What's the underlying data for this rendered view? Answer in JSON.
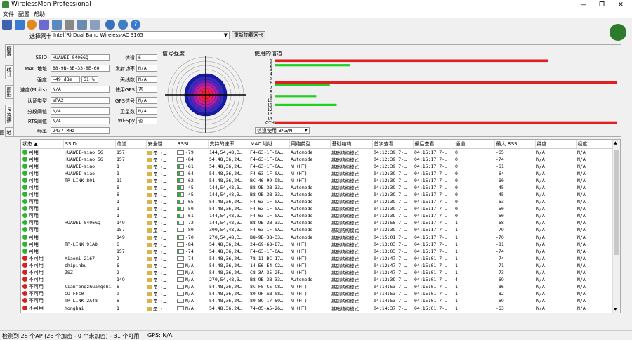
{
  "window": {
    "title": "WirelessMon Professional",
    "minimize": "—",
    "maximize": "❐",
    "close": "✕"
  },
  "menu": [
    "文件",
    "配置",
    "帮助"
  ],
  "toolbar_icons": [
    "save-icon",
    "refresh-icon",
    "settings-icon",
    "export-icon",
    "print-icon",
    "clipboard-icon",
    "map-icon",
    "info-icon",
    "forward-icon",
    "help-icon"
  ],
  "nic": {
    "label": "选择网卡",
    "value": "Intel(R) Dual Band Wireless-AC 3165",
    "reload": "重新加载网卡"
  },
  "side_tabs": [
    "概要",
    "统计",
    "图形",
    "IP 连接",
    "地图"
  ],
  "summary": {
    "ssid": {
      "label": "SSID",
      "value": "HUAWEI-0406GQ"
    },
    "mac": {
      "label": "MAC 地址",
      "value": "B8-9B-3B-33-8E-60"
    },
    "strength": {
      "label": "强度",
      "value": "-49 dBm",
      "pct": "51 %"
    },
    "speed": {
      "label": "速度(Mbits)",
      "value": "N/A"
    },
    "auth": {
      "label": "认证类型",
      "value": "WPA2"
    },
    "frag": {
      "label": "分段阈值",
      "value": "N/A"
    },
    "rts": {
      "label": "RTS阈值",
      "value": "N/A"
    },
    "freq": {
      "label": "频率",
      "value": "2437 MHz"
    },
    "channel": {
      "label": "信道",
      "value": "6"
    },
    "txpower": {
      "label": "发射功率",
      "value": "N/A"
    },
    "antenna": {
      "label": "天线数",
      "value": "N/A"
    },
    "gps": {
      "label": "使用GPS",
      "value": "否"
    },
    "gpssig": {
      "label": "GPS信号",
      "value": "N/A"
    },
    "sat": {
      "label": "卫星数",
      "value": "N/A"
    },
    "wispy": {
      "label": "Wi-Spy",
      "value": "否"
    },
    "signal_title": "信号强度",
    "channel_title": "使用的信道",
    "channel_mode": "信道使用 B/G/N"
  },
  "channel_usage": {
    "labels": [
      "1",
      "2",
      "3",
      "4",
      "5",
      "6",
      "7",
      "8",
      "9",
      "10",
      "11",
      "12",
      "13",
      "14",
      "OTH"
    ],
    "red": [
      0.8,
      0,
      0,
      0,
      0,
      1.0,
      0,
      0,
      0,
      0,
      0,
      0,
      0,
      0,
      1.0
    ],
    "green": [
      0,
      0.22,
      0,
      0,
      0,
      0.16,
      0,
      0,
      0.12,
      0,
      0.18,
      0,
      0,
      0,
      0
    ]
  },
  "table": {
    "columns": [
      "状态",
      "SSID",
      "信道",
      "安全性",
      "RSSI",
      "支持的速率",
      "MAC 地址",
      "网络类型",
      "基础结构",
      "首次查看",
      "最后查看",
      "通道",
      "最大 RSSI",
      "纬度",
      "经度"
    ],
    "rows": [
      [
        "可用",
        "HUAWEI-miao_5G",
        "157",
        "是 (…",
        "-79",
        "144,54,48,3…",
        "F4-63-1F-0A…",
        "Automode",
        "基础结构模式",
        "04:12:39 7-…",
        "04:15:17 7-…",
        "0",
        "-65",
        "N/A",
        "N/A"
      ],
      [
        "可用",
        "HUAWEI-miao_5G",
        "157",
        "是 (…",
        "-84",
        "54,48,36,24…",
        "F4-63-1F-0A…",
        "Automode",
        "基础结构模式",
        "04:12:39 7-…",
        "04:15:17 7-…",
        "0",
        "-74",
        "N/A",
        "N/A"
      ],
      [
        "可用",
        "HUAWEI-miao",
        "1",
        "是 (…",
        "-61",
        "54,48,36,24…",
        "F4-63-1F-0A…",
        "N (HT)",
        "基础结构模式",
        "04:12:39 7-…",
        "04:15:17 7-…",
        "0",
        "-61",
        "N/A",
        "N/A"
      ],
      [
        "可用",
        "HUAWEI-miao",
        "1",
        "是 (…",
        "-64",
        "54,48,36,24…",
        "F4-63-1F-0A…",
        "N (HT)",
        "基础结构模式",
        "04:12:39 7-…",
        "04:15:17 7-…",
        "0",
        "-64",
        "N/A",
        "N/A"
      ],
      [
        "可用",
        "TP-LINK_801",
        "11",
        "是 (…",
        "-62",
        "54,48,36,24…",
        "BC-46-99-98…",
        "N (HT)",
        "基础结构模式",
        "04:12:39 7-…",
        "04:15:17 7-…",
        "0",
        "-60",
        "N/A",
        "N/A"
      ],
      [
        "可用",
        "",
        "6",
        "是 (…",
        "-45",
        "144,54,48,3…",
        "B8-9B-3B-33…",
        "Automode",
        "基础结构模式",
        "04:12:39 7-…",
        "04:15:17 7-…",
        "0",
        "-45",
        "N/A",
        "N/A"
      ],
      [
        "可用",
        "",
        "6",
        "是 (…",
        "-45",
        "144,54,48,3…",
        "B8-9B-3B-33…",
        "Automode",
        "基础结构模式",
        "04:12:39 7-…",
        "04:15:17 7-…",
        "0",
        "-45",
        "N/A",
        "N/A"
      ],
      [
        "可用",
        "",
        "1",
        "是 (…",
        "-65",
        "54,48,36,24…",
        "F4-63-1F-0A…",
        "Automode",
        "基础结构模式",
        "04:12:39 7-…",
        "04:15:17 7-…",
        "0",
        "-63",
        "N/A",
        "N/A"
      ],
      [
        "可用",
        "",
        "1",
        "是 (…",
        "-50",
        "54,48,36,24…",
        "F4-63-1F-0A…",
        "Automode",
        "基础结构模式",
        "04:12:39 7-…",
        "04:15:17 7-…",
        "0",
        "-50",
        "N/A",
        "N/A"
      ],
      [
        "可用",
        "",
        "1",
        "是 (…",
        "-61",
        "144,54,48,3…",
        "F4-63-1F-0A…",
        "Automode",
        "基础结构模式",
        "04:12:39 7-…",
        "04:15:17 7-…",
        "0",
        "-60",
        "N/A",
        "N/A"
      ],
      [
        "可用",
        "HUAWEI-0406GQ",
        "149",
        "是 (…",
        "-72",
        "144,54,48,3…",
        "B8-9B-3B-33…",
        "Automode",
        "基础结构模式",
        "04:12:55 7-…",
        "04:15:17 7-…",
        "1",
        "-68",
        "N/A",
        "N/A"
      ],
      [
        "可用",
        "",
        "157",
        "是 (…",
        "-80",
        "300,54,48,3…",
        "F4-63-1F-0A…",
        "Automode",
        "基础结构模式",
        "04:12:39 7-…",
        "04:15:17 7-…",
        "1",
        "-79",
        "N/A",
        "N/A"
      ],
      [
        "可用",
        "",
        "149",
        "是 (…",
        "-70",
        "270,54,48,3…",
        "B8-9B-3B-33…",
        "Automode",
        "基础结构模式",
        "04:15:01 7-…",
        "04:15:17 7-…",
        "1",
        "-70",
        "N/A",
        "N/A"
      ],
      [
        "可用",
        "TP-LINK_91AD",
        "6",
        "是 (…",
        "-84",
        "54,48,36,24…",
        "24-69-68-B7…",
        "N (HT)",
        "基础结构模式",
        "04:13:03 7-…",
        "04:15:17 7-…",
        "1",
        "-81",
        "N/A",
        "N/A"
      ],
      [
        "可用",
        "",
        "157",
        "是 (…",
        "-74",
        "54,48,36,24…",
        "F4-63-1F-0A…",
        "N (HT)",
        "基础结构模式",
        "04:13:03 7-…",
        "04:15:17 7-…",
        "1",
        "-74",
        "N/A",
        "N/A"
      ],
      [
        "不可用",
        "Xiaomi_2167",
        "2",
        "是 (…",
        "-74",
        "54,48,36,24…",
        "78-11-DC-17…",
        "N (HT)",
        "基础结构模式",
        "04:12:47 7-…",
        "04:15:01 7-…",
        "1",
        "-74",
        "N/A",
        "N/A"
      ],
      [
        "不可用",
        "shipinbu",
        "6",
        "是 (…",
        "N/A",
        "54,48,36,24…",
        "14-E6-E4-C2…",
        "N (HT)",
        "基础结构模式",
        "04:12:47 7-…",
        "04:15:01 7-…",
        "1",
        "-71",
        "N/A",
        "N/A"
      ],
      [
        "不可用",
        "ZSZ",
        "2",
        "是 (…",
        "N/A",
        "54,48,36,24…",
        "C8-3A-35-2F…",
        "N (HT)",
        "基础结构模式",
        "04:12:47 7-…",
        "04:15:01 7-…",
        "1",
        "-73",
        "N/A",
        "N/A"
      ],
      [
        "不可用",
        "",
        "149",
        "是 (…",
        "N/A",
        "270,54,48,3…",
        "B8-9B-3B-33…",
        "Automode",
        "基础结构模式",
        "04:12:39 7-…",
        "04:15:01 7-…",
        "4",
        "-69",
        "N/A",
        "N/A"
      ],
      [
        "不可用",
        "lianfengzhuangshi",
        "6",
        "是 (…",
        "N/A",
        "54,48,36,24…",
        "8C-F8-C5-C8…",
        "N (HT)",
        "基础结构模式",
        "04:14:53 7-…",
        "04:15:01 7-…",
        "1",
        "-86",
        "N/A",
        "N/A"
      ],
      [
        "不可用",
        "CU_FFs0",
        "9",
        "是 (…",
        "N/A",
        "54,48,36,24…",
        "80-9F-AB-08…",
        "N (HT)",
        "基础结构模式",
        "04:14:53 7-…",
        "04:15:01 7-…",
        "1",
        "-82",
        "N/A",
        "N/A"
      ],
      [
        "不可用",
        "TP-LINK_2A48",
        "6",
        "是 (…",
        "N/A",
        "54,48,36,24…",
        "80-89-17-59…",
        "N (HT)",
        "基础结构模式",
        "04:14:53 7-…",
        "04:15:01 7-…",
        "1",
        "-69",
        "N/A",
        "N/A"
      ],
      [
        "不可用",
        "honghai",
        "1",
        "是 (…",
        "N/A",
        "54,48,36,24…",
        "74-05-A5-26…",
        "N (HT)",
        "基础结构模式",
        "04:14:37 7-…",
        "04:15:01 7-…",
        "1",
        "-63",
        "N/A",
        "N/A"
      ],
      [
        "不可用",
        "TP-LINK_1101",
        "1",
        "是 (…",
        "N/A",
        "54,48,36,24…",
        "C6-6F-73-E1…",
        "N (HT)",
        "基础结构模式",
        "04:14:37 7-…",
        "04:15:01 7-…",
        "1",
        "-80",
        "N/A",
        "N/A"
      ]
    ],
    "rssi_levels": [
      0.15,
      0.1,
      0.4,
      0.35,
      0.4,
      0.65,
      0.65,
      0.35,
      0.6,
      0.4,
      0.25,
      0.15,
      0.3,
      0.1,
      0.25,
      0,
      0,
      0,
      0,
      0,
      0,
      0,
      0,
      0
    ]
  },
  "status": {
    "text": "检测到 28 个AP (28 个加密 - 0 个未加密) - 31 个可用",
    "gps": "GPS: N/A"
  },
  "colors": {
    "available": "#2db52d",
    "unavailable": "#d42222",
    "channel_red": "#e02020",
    "channel_green": "#22d022"
  }
}
